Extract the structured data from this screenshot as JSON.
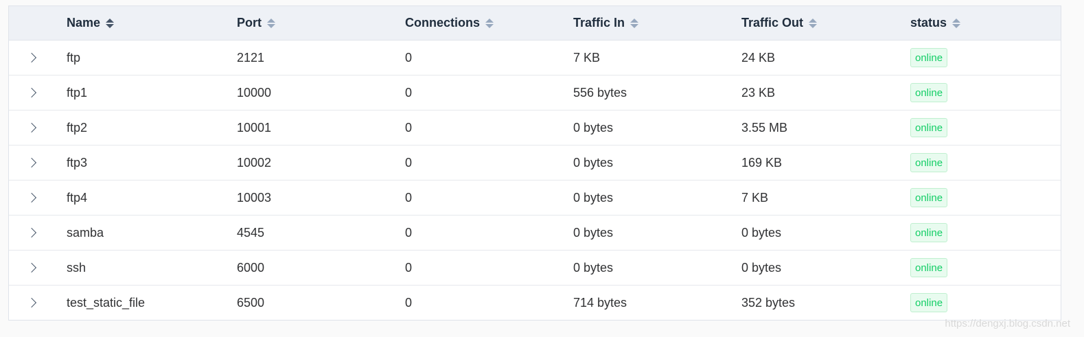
{
  "colors": {
    "header_bg": "#eef1f6",
    "status_online": "#13ce66",
    "status_online_bg": "#e8fbef",
    "border": "#dfe3ea"
  },
  "table": {
    "columns": [
      {
        "label": "Name",
        "sortable": true,
        "sort_active": true
      },
      {
        "label": "Port",
        "sortable": true
      },
      {
        "label": "Connections",
        "sortable": true
      },
      {
        "label": "Traffic In",
        "sortable": true
      },
      {
        "label": "Traffic Out",
        "sortable": true
      },
      {
        "label": "status",
        "sortable": true
      }
    ],
    "rows": [
      {
        "name": "ftp",
        "port": "2121",
        "connections": "0",
        "traffic_in": "7 KB",
        "traffic_out": "24 KB",
        "status": "online"
      },
      {
        "name": "ftp1",
        "port": "10000",
        "connections": "0",
        "traffic_in": "556 bytes",
        "traffic_out": "23 KB",
        "status": "online"
      },
      {
        "name": "ftp2",
        "port": "10001",
        "connections": "0",
        "traffic_in": "0 bytes",
        "traffic_out": "3.55 MB",
        "status": "online"
      },
      {
        "name": "ftp3",
        "port": "10002",
        "connections": "0",
        "traffic_in": "0 bytes",
        "traffic_out": "169 KB",
        "status": "online"
      },
      {
        "name": "ftp4",
        "port": "10003",
        "connections": "0",
        "traffic_in": "0 bytes",
        "traffic_out": "7 KB",
        "status": "online"
      },
      {
        "name": "samba",
        "port": "4545",
        "connections": "0",
        "traffic_in": "0 bytes",
        "traffic_out": "0 bytes",
        "status": "online"
      },
      {
        "name": "ssh",
        "port": "6000",
        "connections": "0",
        "traffic_in": "0 bytes",
        "traffic_out": "0 bytes",
        "status": "online"
      },
      {
        "name": "test_static_file",
        "port": "6500",
        "connections": "0",
        "traffic_in": "714 bytes",
        "traffic_out": "352 bytes",
        "status": "online"
      }
    ]
  },
  "watermark": "https://dengxj.blog.csdn.net"
}
